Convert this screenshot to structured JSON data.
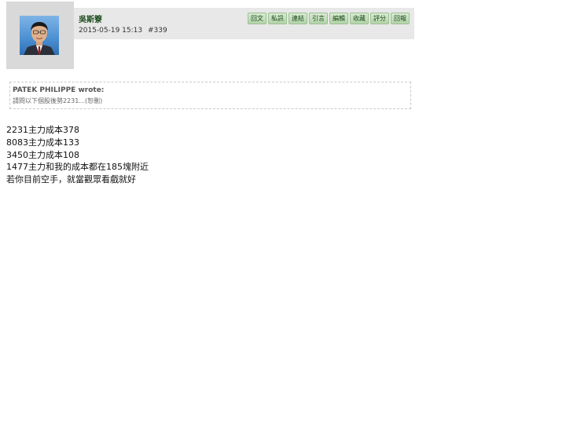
{
  "post": {
    "author": "吳斯簝",
    "date": "2015-05-19 15:13",
    "number": "#339",
    "actions": [
      "回文",
      "私訊",
      "連結",
      "引言",
      "編輯",
      "收藏",
      "評分",
      "回報"
    ],
    "quote": {
      "author": "PATEK PHILIPPE wrote:",
      "text": "請問以下個股後勢2231...(恕刪)"
    },
    "body_lines": [
      "2231主力成本378",
      "8083主力成本133",
      "3450主力成本108",
      "1477主力和我的成本都在185塊附近",
      "若你目前空手，就當觀眾看戲就好"
    ]
  },
  "colors": {
    "header_bg": "#e8e8e8",
    "avatar_frame": "#d9d9d9",
    "author_green": "#1f4d1f",
    "button_green": "#b3d3a8"
  }
}
